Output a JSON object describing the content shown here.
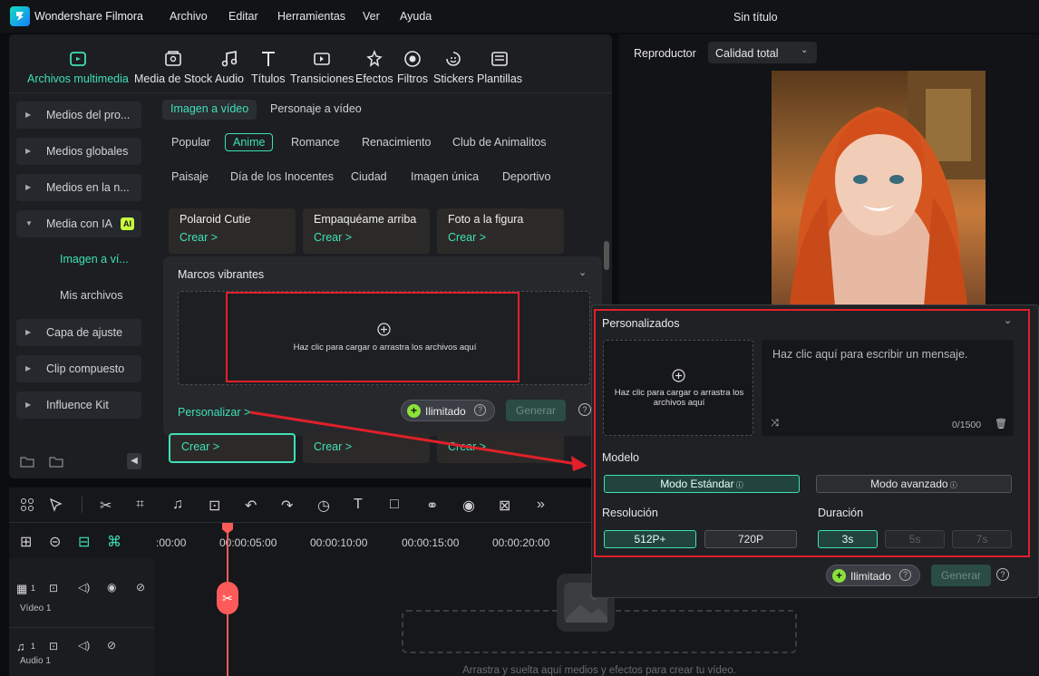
{
  "app": {
    "name": "Wondershare Filmora",
    "title": "Sin título"
  },
  "menu": [
    "Archivo",
    "Editar",
    "Herramientas",
    "Ver",
    "Ayuda"
  ],
  "toolbar": [
    {
      "label": "Archivos multimedia",
      "icon": "media-icon",
      "active": true
    },
    {
      "label": "Media de Stock",
      "icon": "stock-media-icon"
    },
    {
      "label": "Audio",
      "icon": "audio-icon"
    },
    {
      "label": "Títulos",
      "icon": "titles-icon"
    },
    {
      "label": "Transiciones",
      "icon": "transitions-icon"
    },
    {
      "label": "Efectos",
      "icon": "effects-icon"
    },
    {
      "label": "Filtros",
      "icon": "filters-icon"
    },
    {
      "label": "Stickers",
      "icon": "stickers-icon"
    },
    {
      "label": "Plantillas",
      "icon": "templates-icon"
    }
  ],
  "sidebar": {
    "items": [
      "Medios del pro...",
      "Medios globales",
      "Medios en la n...",
      "Media con IA",
      "Capa de ajuste",
      "Clip compuesto",
      "Influence Kit"
    ],
    "ai_badge": "AI",
    "sub_items": [
      "Imagen a ví...",
      "Mis archivos"
    ]
  },
  "tabs": [
    "Imagen a vídeo",
    "Personaje a vídeo"
  ],
  "chips_row1": [
    "Popular",
    "Anime",
    "Romance",
    "Renacimiento",
    "Club de Animalitos"
  ],
  "chips_row2": [
    "Paisaje",
    "Día de los Inocentes",
    "Ciudad",
    "Imagen única",
    "Deportivo"
  ],
  "cards_top": [
    {
      "title": "Polaroid Cutie",
      "action": "Crear >"
    },
    {
      "title": "Empaquéame arriba",
      "action": "Crear >"
    },
    {
      "title": "Foto a la figura",
      "action": "Crear >"
    }
  ],
  "cards_bottom": [
    "Crear >",
    "Crear >",
    "Crear >"
  ],
  "marcos": {
    "title": "Marcos vibrantes",
    "upload_text": "Haz clic para cargar o arrastra los archivos aquí",
    "personalize": "Personalizar >",
    "unlimited": "Ilimitado",
    "generate": "Generar"
  },
  "player": {
    "label": "Reproductor",
    "quality": "Calidad total"
  },
  "popup": {
    "title": "Personalizados",
    "upload_text": "Haz clic para cargar o arrastra los archivos aquí",
    "prompt_placeholder": "Haz clic aquí para escribir un mensaje.",
    "counter": "0/1500",
    "model_label": "Modelo",
    "model_standard": "Modo Estándar",
    "model_advanced": "Modo avanzado",
    "resolution_label": "Resolución",
    "res_options": [
      "512P+",
      "720P"
    ],
    "duration_label": "Duración",
    "dur_options": [
      "3s",
      "5s",
      "7s"
    ],
    "unlimited": "Ilimitado",
    "generate": "Generar"
  },
  "timeline": {
    "timestamps": [
      ":00:00",
      "00:00:05:00",
      "00:00:10:00",
      "00:00:15:00",
      "00:00:20:00"
    ],
    "tracks": [
      {
        "name": "Vídeo 1",
        "num": "1"
      },
      {
        "name": "Audio 1",
        "num": "1"
      }
    ],
    "drop_hint": "Arrastra y suelta aquí medios y efectos para crear tu vídeo."
  },
  "colors": {
    "accent": "#3fe0b7",
    "highlight": "#e0202a",
    "playhead": "#ff5a5a"
  }
}
